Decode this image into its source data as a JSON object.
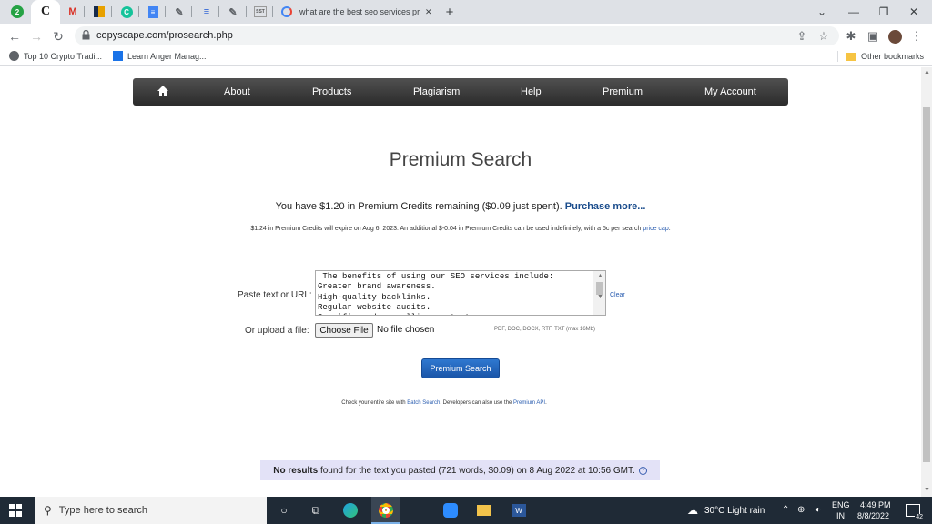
{
  "browser": {
    "tab_favicons": [
      "2",
      "C",
      "M",
      "▮",
      "C",
      "≡",
      "✎",
      "≡",
      "✎",
      "SST"
    ],
    "long_tab_title": "what are the best seo services pr",
    "tab_close": "✕",
    "new_tab": "+",
    "url": "copyscape.com/prosearch.php",
    "bookmarks": [
      {
        "label": "Top 10 Crypto Tradi..."
      },
      {
        "label": "Learn Anger Manag..."
      }
    ],
    "other_bookmarks": "Other bookmarks"
  },
  "nav": {
    "items": [
      "About",
      "Products",
      "Plagiarism",
      "Help",
      "Premium",
      "My Account"
    ]
  },
  "main": {
    "title": "Premium Search",
    "credits_text": "You have $1.20 in Premium Credits remaining ($0.09 just spent).",
    "purchase_link": "Purchase more...",
    "expire_text": "$1.24 in Premium Credits will expire on Aug 6, 2023. An additional $-0.04 in Premium Credits can be used indefinitely, with a 5c per search",
    "price_cap_link": "price cap",
    "expire_end": ".",
    "paste_label": "Paste text or URL:",
    "textarea_value": " The benefits of using our SEO services include:\nGreater brand awareness.\nHigh-quality backlinks.\nRegular website audits.\nSpecific and compelling content.",
    "clear_link": "Clear",
    "upload_label": "Or upload a file:",
    "choose_file": "Choose File",
    "file_status": "No file chosen",
    "file_types": "PDF, DOC, DOCX, RTF, TXT (max 16Mb)",
    "search_button": "Premium Search",
    "batch_pre": "Check your entire site with",
    "batch_link": "Batch Search",
    "batch_mid": ". Developers can also use the",
    "api_link": "Premium API",
    "batch_end": ".",
    "results_bold": "No results",
    "results_text": " found for the text you pasted (721 words, $0.09) on 8 Aug 2022 at 10:56 GMT.",
    "results_icon": "?"
  },
  "taskbar": {
    "search_placeholder": "Type here to search",
    "weather": "30°C  Light rain",
    "lang_top": "ENG",
    "lang_bottom": "IN",
    "time": "4:49 PM",
    "date": "8/8/2022",
    "notification_count": "42"
  },
  "colors": {
    "nav_bg": "#3a3a3a",
    "link": "#1a4c8c",
    "button": "#1f62bd",
    "results_bg": "#e3e2f7"
  }
}
